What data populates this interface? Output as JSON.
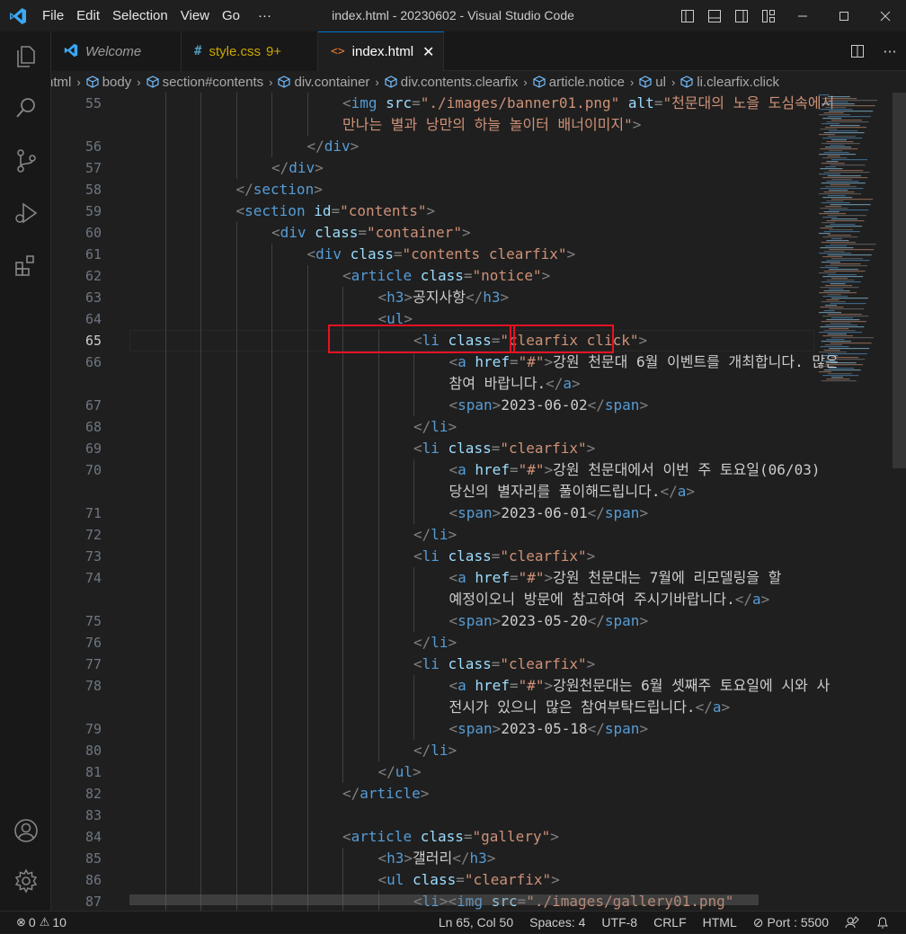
{
  "titlebar": {
    "menu": [
      "File",
      "Edit",
      "Selection",
      "View",
      "Go",
      "···"
    ],
    "title": "index.html - 20230602 - Visual Studio Code"
  },
  "tabs": [
    {
      "label": "Welcome",
      "icon": "vscode-icon",
      "active": false
    },
    {
      "label": "style.css",
      "badge": "9+",
      "icon": "hash-icon",
      "active": false
    },
    {
      "label": "index.html",
      "icon": "html-icon",
      "active": true
    }
  ],
  "breadcrumb": [
    "html",
    "body",
    "section#contents",
    "div.container",
    "div.contents.clearfix",
    "article.notice",
    "ul",
    "li.clearfix.click"
  ],
  "editor": {
    "current_line": 65,
    "lines": [
      {
        "n": "55",
        "indent": 6,
        "t": [
          [
            "p",
            "<"
          ],
          [
            "g",
            "img"
          ],
          [
            "a",
            " src"
          ],
          [
            "p",
            "="
          ],
          [
            "s",
            "\"./images/banner01.png\""
          ],
          [
            "a",
            " alt"
          ],
          [
            "p",
            "="
          ],
          [
            "s",
            "\"천문대의 노을 도심속에서"
          ]
        ]
      },
      {
        "n": "",
        "indent": 6,
        "t": [
          [
            "s",
            "만나는 별과 낭만의 하늘 놀이터 배너이미지\""
          ],
          [
            "p",
            ">"
          ]
        ]
      },
      {
        "n": "56",
        "indent": 5,
        "t": [
          [
            "p",
            "</"
          ],
          [
            "g",
            "div"
          ],
          [
            "p",
            ">"
          ]
        ]
      },
      {
        "n": "57",
        "indent": 4,
        "t": [
          [
            "p",
            "</"
          ],
          [
            "g",
            "div"
          ],
          [
            "p",
            ">"
          ]
        ]
      },
      {
        "n": "58",
        "indent": 3,
        "t": [
          [
            "p",
            "</"
          ],
          [
            "g",
            "section"
          ],
          [
            "p",
            ">"
          ]
        ]
      },
      {
        "n": "59",
        "indent": 3,
        "t": [
          [
            "p",
            "<"
          ],
          [
            "g",
            "section"
          ],
          [
            "a",
            " id"
          ],
          [
            "p",
            "="
          ],
          [
            "s",
            "\"contents\""
          ],
          [
            "p",
            ">"
          ]
        ]
      },
      {
        "n": "60",
        "indent": 4,
        "t": [
          [
            "p",
            "<"
          ],
          [
            "g",
            "div"
          ],
          [
            "a",
            " class"
          ],
          [
            "p",
            "="
          ],
          [
            "s",
            "\"container\""
          ],
          [
            "p",
            ">"
          ]
        ]
      },
      {
        "n": "61",
        "indent": 5,
        "t": [
          [
            "p",
            "<"
          ],
          [
            "g",
            "div"
          ],
          [
            "a",
            " class"
          ],
          [
            "p",
            "="
          ],
          [
            "s",
            "\"contents clearfix\""
          ],
          [
            "p",
            ">"
          ]
        ]
      },
      {
        "n": "62",
        "indent": 6,
        "t": [
          [
            "p",
            "<"
          ],
          [
            "g",
            "article"
          ],
          [
            "a",
            " class"
          ],
          [
            "p",
            "="
          ],
          [
            "s",
            "\"notice\""
          ],
          [
            "p",
            ">"
          ]
        ]
      },
      {
        "n": "63",
        "indent": 7,
        "t": [
          [
            "p",
            "<"
          ],
          [
            "g",
            "h3"
          ],
          [
            "p",
            ">"
          ],
          [
            "x",
            "공지사항"
          ],
          [
            "p",
            "</"
          ],
          [
            "g",
            "h3"
          ],
          [
            "p",
            ">"
          ]
        ]
      },
      {
        "n": "64",
        "indent": 7,
        "t": [
          [
            "p",
            "<"
          ],
          [
            "g",
            "ul"
          ],
          [
            "p",
            ">"
          ]
        ]
      },
      {
        "n": "65",
        "indent": 8,
        "t": [
          [
            "p",
            "<"
          ],
          [
            "g",
            "li"
          ],
          [
            "a",
            " class"
          ],
          [
            "p",
            "="
          ],
          [
            "s",
            "\"clearfix click\""
          ],
          [
            "p",
            ">"
          ]
        ]
      },
      {
        "n": "66",
        "indent": 9,
        "t": [
          [
            "p",
            "<"
          ],
          [
            "g",
            "a"
          ],
          [
            "a",
            " href"
          ],
          [
            "p",
            "="
          ],
          [
            "s",
            "\"#\""
          ],
          [
            "p",
            ">"
          ],
          [
            "x",
            "강원 천문대 6월 이벤트를 개최합니다. 많은"
          ]
        ]
      },
      {
        "n": "",
        "indent": 9,
        "t": [
          [
            "x",
            "참여 바랍니다."
          ],
          [
            "p",
            "</"
          ],
          [
            "g",
            "a"
          ],
          [
            "p",
            ">"
          ]
        ]
      },
      {
        "n": "67",
        "indent": 9,
        "t": [
          [
            "p",
            "<"
          ],
          [
            "g",
            "span"
          ],
          [
            "p",
            ">"
          ],
          [
            "x",
            "2023-06-02"
          ],
          [
            "p",
            "</"
          ],
          [
            "g",
            "span"
          ],
          [
            "p",
            ">"
          ]
        ]
      },
      {
        "n": "68",
        "indent": 8,
        "t": [
          [
            "p",
            "</"
          ],
          [
            "g",
            "li"
          ],
          [
            "p",
            ">"
          ]
        ]
      },
      {
        "n": "69",
        "indent": 8,
        "t": [
          [
            "p",
            "<"
          ],
          [
            "g",
            "li"
          ],
          [
            "a",
            " class"
          ],
          [
            "p",
            "="
          ],
          [
            "s",
            "\"clearfix\""
          ],
          [
            "p",
            ">"
          ]
        ]
      },
      {
        "n": "70",
        "indent": 9,
        "t": [
          [
            "p",
            "<"
          ],
          [
            "g",
            "a"
          ],
          [
            "a",
            " href"
          ],
          [
            "p",
            "="
          ],
          [
            "s",
            "\"#\""
          ],
          [
            "p",
            ">"
          ],
          [
            "x",
            "강원 천문대에서 이번 주 토요일(06/03)"
          ]
        ]
      },
      {
        "n": "",
        "indent": 9,
        "t": [
          [
            "x",
            "당신의 별자리를 풀이해드립니다."
          ],
          [
            "p",
            "</"
          ],
          [
            "g",
            "a"
          ],
          [
            "p",
            ">"
          ]
        ]
      },
      {
        "n": "71",
        "indent": 9,
        "t": [
          [
            "p",
            "<"
          ],
          [
            "g",
            "span"
          ],
          [
            "p",
            ">"
          ],
          [
            "x",
            "2023-06-01"
          ],
          [
            "p",
            "</"
          ],
          [
            "g",
            "span"
          ],
          [
            "p",
            ">"
          ]
        ]
      },
      {
        "n": "72",
        "indent": 8,
        "t": [
          [
            "p",
            "</"
          ],
          [
            "g",
            "li"
          ],
          [
            "p",
            ">"
          ]
        ]
      },
      {
        "n": "73",
        "indent": 8,
        "t": [
          [
            "p",
            "<"
          ],
          [
            "g",
            "li"
          ],
          [
            "a",
            " class"
          ],
          [
            "p",
            "="
          ],
          [
            "s",
            "\"clearfix\""
          ],
          [
            "p",
            ">"
          ]
        ]
      },
      {
        "n": "74",
        "indent": 9,
        "t": [
          [
            "p",
            "<"
          ],
          [
            "g",
            "a"
          ],
          [
            "a",
            " href"
          ],
          [
            "p",
            "="
          ],
          [
            "s",
            "\"#\""
          ],
          [
            "p",
            ">"
          ],
          [
            "x",
            "강원 천문대는 7월에 리모델링을 할"
          ]
        ]
      },
      {
        "n": "",
        "indent": 9,
        "t": [
          [
            "x",
            "예정이오니 방문에 참고하여 주시기바랍니다."
          ],
          [
            "p",
            "</"
          ],
          [
            "g",
            "a"
          ],
          [
            "p",
            ">"
          ]
        ]
      },
      {
        "n": "75",
        "indent": 9,
        "t": [
          [
            "p",
            "<"
          ],
          [
            "g",
            "span"
          ],
          [
            "p",
            ">"
          ],
          [
            "x",
            "2023-05-20"
          ],
          [
            "p",
            "</"
          ],
          [
            "g",
            "span"
          ],
          [
            "p",
            ">"
          ]
        ]
      },
      {
        "n": "76",
        "indent": 8,
        "t": [
          [
            "p",
            "</"
          ],
          [
            "g",
            "li"
          ],
          [
            "p",
            ">"
          ]
        ]
      },
      {
        "n": "77",
        "indent": 8,
        "t": [
          [
            "p",
            "<"
          ],
          [
            "g",
            "li"
          ],
          [
            "a",
            " class"
          ],
          [
            "p",
            "="
          ],
          [
            "s",
            "\"clearfix\""
          ],
          [
            "p",
            ">"
          ]
        ]
      },
      {
        "n": "78",
        "indent": 9,
        "t": [
          [
            "p",
            "<"
          ],
          [
            "g",
            "a"
          ],
          [
            "a",
            " href"
          ],
          [
            "p",
            "="
          ],
          [
            "s",
            "\"#\""
          ],
          [
            "p",
            ">"
          ],
          [
            "x",
            "강원천문대는 6월 셋째주 토요일에 시와 사"
          ]
        ]
      },
      {
        "n": "",
        "indent": 9,
        "t": [
          [
            "x",
            "전시가 있으니 많은 참여부탁드립니다."
          ],
          [
            "p",
            "</"
          ],
          [
            "g",
            "a"
          ],
          [
            "p",
            ">"
          ]
        ]
      },
      {
        "n": "79",
        "indent": 9,
        "t": [
          [
            "p",
            "<"
          ],
          [
            "g",
            "span"
          ],
          [
            "p",
            ">"
          ],
          [
            "x",
            "2023-05-18"
          ],
          [
            "p",
            "</"
          ],
          [
            "g",
            "span"
          ],
          [
            "p",
            ">"
          ]
        ]
      },
      {
        "n": "80",
        "indent": 8,
        "t": [
          [
            "p",
            "</"
          ],
          [
            "g",
            "li"
          ],
          [
            "p",
            ">"
          ]
        ]
      },
      {
        "n": "81",
        "indent": 7,
        "t": [
          [
            "p",
            "</"
          ],
          [
            "g",
            "ul"
          ],
          [
            "p",
            ">"
          ]
        ]
      },
      {
        "n": "82",
        "indent": 6,
        "t": [
          [
            "p",
            "</"
          ],
          [
            "g",
            "article"
          ],
          [
            "p",
            ">"
          ]
        ]
      },
      {
        "n": "83",
        "indent": 0,
        "t": []
      },
      {
        "n": "84",
        "indent": 6,
        "t": [
          [
            "p",
            "<"
          ],
          [
            "g",
            "article"
          ],
          [
            "a",
            " class"
          ],
          [
            "p",
            "="
          ],
          [
            "s",
            "\"gallery\""
          ],
          [
            "p",
            ">"
          ]
        ]
      },
      {
        "n": "85",
        "indent": 7,
        "t": [
          [
            "p",
            "<"
          ],
          [
            "g",
            "h3"
          ],
          [
            "p",
            ">"
          ],
          [
            "x",
            "갤러리"
          ],
          [
            "p",
            "</"
          ],
          [
            "g",
            "h3"
          ],
          [
            "p",
            ">"
          ]
        ]
      },
      {
        "n": "86",
        "indent": 7,
        "t": [
          [
            "p",
            "<"
          ],
          [
            "g",
            "ul"
          ],
          [
            "a",
            " class"
          ],
          [
            "p",
            "="
          ],
          [
            "s",
            "\"clearfix\""
          ],
          [
            "p",
            ">"
          ]
        ]
      },
      {
        "n": "87",
        "indent": 8,
        "t": [
          [
            "p",
            "<"
          ],
          [
            "g",
            "li"
          ],
          [
            "p",
            "><"
          ],
          [
            "g",
            "img"
          ],
          [
            "a",
            " src"
          ],
          [
            "p",
            "="
          ],
          [
            "s",
            "\"./images/gallery01.png\""
          ]
        ]
      }
    ]
  },
  "statusbar": {
    "errors": "0",
    "warnings": "10",
    "cursor": "Ln 65, Col 50",
    "spaces": "Spaces: 4",
    "encoding": "UTF-8",
    "eol": "CRLF",
    "language": "HTML",
    "port": "Port : 5500"
  },
  "colors": {
    "accent": "#0078d4",
    "highlight_box": "#e81123",
    "tag": "#569cd6",
    "attr": "#9cdcfe",
    "string": "#ce9178"
  }
}
